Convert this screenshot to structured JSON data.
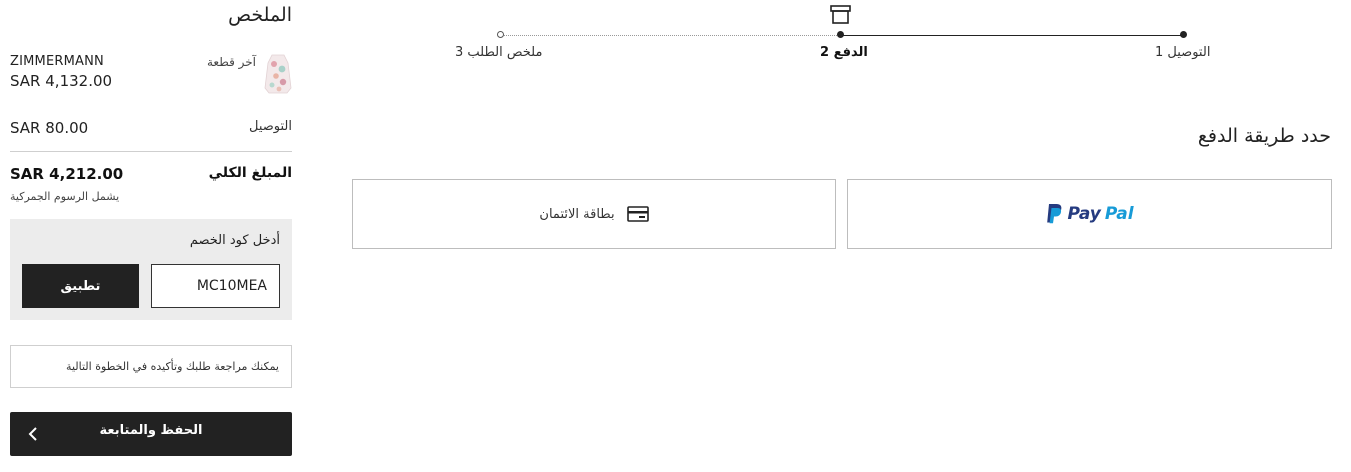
{
  "stepper": {
    "steps": [
      {
        "label": "1 التوصيل"
      },
      {
        "label": "2 الدفع"
      },
      {
        "label": "3 ملخص الطلب"
      }
    ]
  },
  "payment": {
    "title": "حدد طريقة الدفع",
    "paypal": {
      "pay": "Pay",
      "pal": "Pal"
    },
    "credit_label": "بطاقة الائتمان"
  },
  "summary": {
    "title": "الملخص",
    "item": {
      "brand": "ZIMMERMANN",
      "price": "SAR 4,132.00",
      "tag": "آخر قطعة"
    },
    "shipping_label": "التوصيل",
    "shipping_value": "SAR 80.00",
    "total_label": "المبلغ الكلي",
    "total_value": "SAR 4,212.00",
    "customs_note": "يشمل الرسوم الجمركية"
  },
  "promo": {
    "label": "أدخل كود الخصم",
    "value": "MC10MEA",
    "apply_label": "تطبيق"
  },
  "notice": "يمكنك مراجعة طلبك وتأكيده في الخطوة التالية",
  "save_button": "الحفظ والمتابعة",
  "colors": {
    "primary_dark": "#222222",
    "paypal_dark": "#253b80",
    "paypal_light": "#179bd7",
    "promo_bg": "#ececec"
  }
}
